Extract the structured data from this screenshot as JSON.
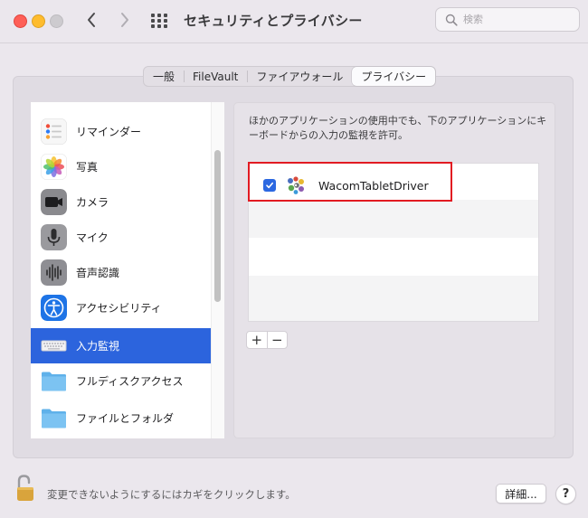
{
  "window": {
    "title": "セキュリティとプライバシー",
    "search": {
      "placeholder": "検索",
      "value": ""
    }
  },
  "tabs": [
    {
      "label": "一般",
      "active": false
    },
    {
      "label": "FileVault",
      "active": false
    },
    {
      "label": "ファイアウォール",
      "active": false
    },
    {
      "label": "プライバシー",
      "active": true
    }
  ],
  "sidebar": {
    "items": [
      {
        "label": "リマインダー",
        "icon": "reminders-icon"
      },
      {
        "label": "写真",
        "icon": "photos-icon"
      },
      {
        "label": "カメラ",
        "icon": "camera-icon"
      },
      {
        "label": "マイク",
        "icon": "microphone-icon"
      },
      {
        "label": "音声認識",
        "icon": "speech-recognition-icon"
      },
      {
        "label": "アクセシビリティ",
        "icon": "accessibility-icon"
      },
      {
        "label": "入力監視",
        "icon": "keyboard-icon",
        "selected": true
      },
      {
        "label": "フルディスクアクセス",
        "icon": "folder-icon"
      },
      {
        "label": "ファイルとフォルダ",
        "icon": "folder-icon"
      }
    ]
  },
  "main": {
    "description": "ほかのアプリケーションの使用中でも、下のアプリケーションにキーボードからの入力の監視を許可。",
    "apps": [
      {
        "name": "WacomTabletDriver",
        "checked": true,
        "icon": "wacom-driver-icon"
      }
    ],
    "add_label": "+",
    "remove_label": "−"
  },
  "footer": {
    "lock_text": "変更できないようにするにはカギをクリックします。",
    "advanced_label": "詳細...",
    "help_label": "?"
  },
  "colors": {
    "selection": "#2c64dd",
    "checkbox": "#2c68e1",
    "highlight_border": "#e21b22"
  }
}
